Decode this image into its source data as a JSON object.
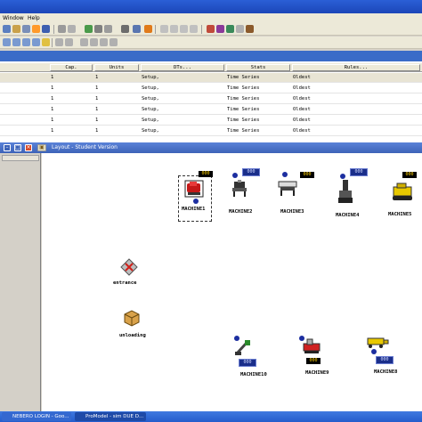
{
  "menu": {
    "window": "Window",
    "help": "Help"
  },
  "grid": {
    "columns": [
      "Cap.",
      "Units",
      "DTs...",
      "Stats",
      "Rules..."
    ],
    "rows": [
      [
        "1",
        "1",
        "Setup,",
        "Time Series",
        "Oldest"
      ],
      [
        "1",
        "1",
        "Setup,",
        "Time Series",
        "Oldest"
      ],
      [
        "1",
        "1",
        "Setup,",
        "Time Series",
        "Oldest"
      ],
      [
        "1",
        "1",
        "Setup,",
        "Time Series",
        "Oldest"
      ],
      [
        "1",
        "1",
        "Setup,",
        "Time Series",
        "Oldest"
      ],
      [
        "1",
        "1",
        "Setup,",
        "Time Series",
        "Oldest"
      ]
    ]
  },
  "layout": {
    "title": "Layout - Student Version",
    "counter_value": "000",
    "queue_value": "000",
    "locations": {
      "machine1": "MACHINE1",
      "machine2": "MACHINE2",
      "machine3": "MACHINE3",
      "machine4": "MACHINE4",
      "machine5": "MACHINE5",
      "entrance": "entrance",
      "unloading": "unloading",
      "machine10": "MACHINE10",
      "machine9": "MACHINE9",
      "machine8": "MACHINE8"
    }
  },
  "taskbar": {
    "items": [
      "NEBERO LOGIN - Goo...",
      "ProModel - sim DUE D..."
    ]
  }
}
